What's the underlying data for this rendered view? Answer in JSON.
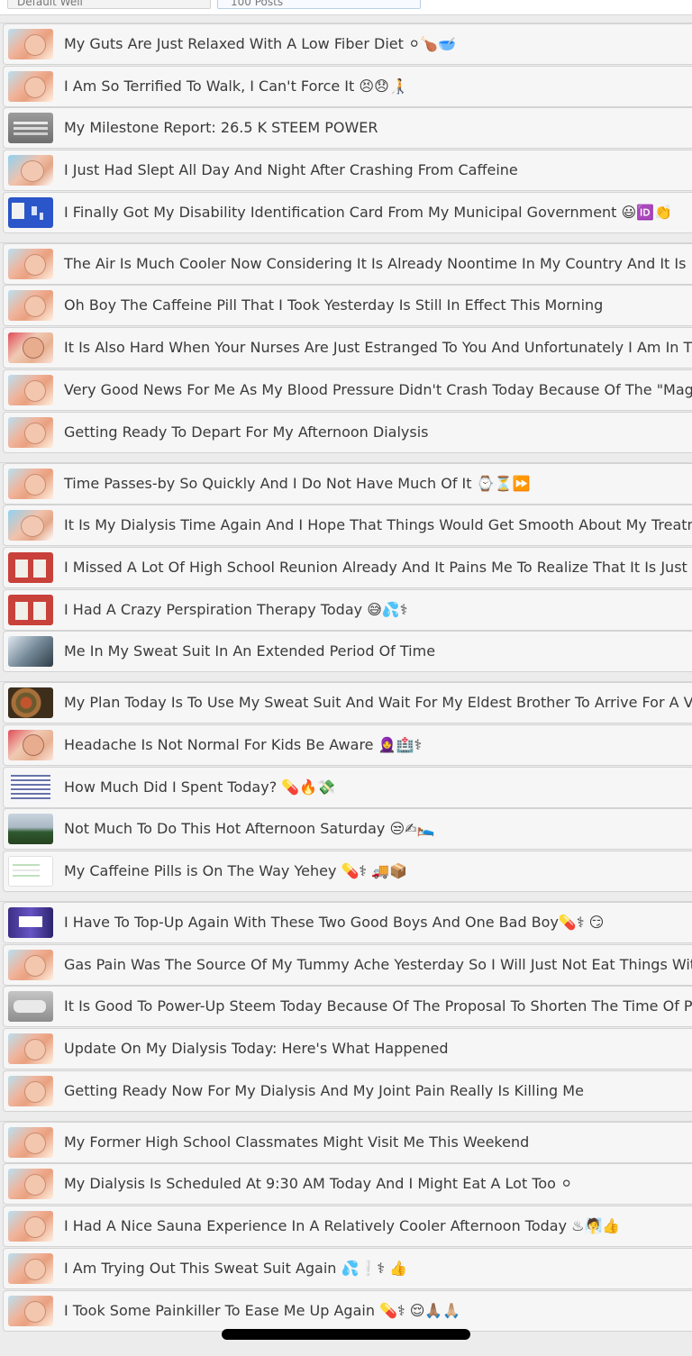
{
  "header": {
    "sort_select": "Default Well",
    "count_select": "100 Posts"
  },
  "groups": [
    {
      "posts": [
        {
          "title": "My Guts Are Just Relaxed With A Low Fiber Diet ⚪🍗🥣",
          "thumb": "face"
        },
        {
          "title": "I Am So Terrified To Walk, I Can't Force It 😣😞🧑‍🦯",
          "thumb": "face"
        },
        {
          "title": "My Milestone Report: 26.5 K STEEM POWER",
          "thumb": "gray"
        },
        {
          "title": "I Just Had Slept All Day And Night After Crashing From Caffeine",
          "thumb": "face3"
        },
        {
          "title": "I Finally Got My Disability Identification Card From My Municipal Government 😃🆔👏",
          "thumb": "card"
        }
      ]
    },
    {
      "posts": [
        {
          "title": "The Air Is Much Cooler Now Considering It Is Already Noontime In My Country And It Is Nice T",
          "thumb": "face"
        },
        {
          "title": "Oh Boy The Caffeine Pill That I Took Yesterday Is Still In Effect This Morning",
          "thumb": "face"
        },
        {
          "title": "It Is Also Hard When Your Nurses Are Just Estranged To You And Unfortunately I Am In That C",
          "thumb": "face2"
        },
        {
          "title": "Very Good News For Me As My Blood Pressure Didn't Crash Today Because Of The \"Magic Bu",
          "thumb": "face"
        },
        {
          "title": "Getting Ready To Depart For My Afternoon Dialysis",
          "thumb": "face"
        }
      ]
    },
    {
      "posts": [
        {
          "title": "Time Passes-by So Quickly And I Do Not Have Much Of It ⌚⏳⏩",
          "thumb": "face"
        },
        {
          "title": "It Is My Dialysis Time Again And I Hope That Things Would Get Smooth About My Treatment S",
          "thumb": "face3"
        },
        {
          "title": "I Missed A Lot Of High School Reunion Already And It Pains Me To Realize That It Is Just Impos",
          "thumb": "red"
        },
        {
          "title": "I Had A Crazy Perspiration Therapy Today 😅💦⚕",
          "thumb": "red"
        },
        {
          "title": "Me In My Sweat Suit In An Extended Period Of Time",
          "thumb": "photo"
        }
      ]
    },
    {
      "posts": [
        {
          "title": "My Plan Today Is To Use My Sweat Suit And Wait For My Eldest Brother To Arrive For A Visit",
          "thumb": "pizza"
        },
        {
          "title": "Headache Is Not Normal For Kids Be Aware 🧕🏥⚕",
          "thumb": "face2"
        },
        {
          "title": "How Much Did I Spent Today? 💊🔥💸",
          "thumb": "sheet"
        },
        {
          "title": "Not Much To Do This Hot Afternoon Saturday 😒✍🛌",
          "thumb": "sky"
        },
        {
          "title": "My Caffeine Pills is On The Way Yehey 💊⚕ 🚚📦",
          "thumb": "white"
        }
      ]
    },
    {
      "posts": [
        {
          "title": "I Have To Top-Up Again With These Two Good Boys And One Bad Boy💊⚕ 😏",
          "thumb": "bottle"
        },
        {
          "title": "Gas Pain Was The Source Of My Tummy Ache Yesterday So I Will Just Not Eat Things With Che",
          "thumb": "face"
        },
        {
          "title": "It Is Good To Power-Up Steem Today Because Of The Proposal To Shorten The Time Of Power",
          "thumb": "silver"
        },
        {
          "title": "Update On My Dialysis Today: Here's What Happened",
          "thumb": "face"
        },
        {
          "title": "Getting Ready Now For My Dialysis And My Joint Pain Really Is Killing Me",
          "thumb": "face"
        }
      ]
    },
    {
      "posts": [
        {
          "title": "My Former High School Classmates Might Visit Me This Weekend",
          "thumb": "face"
        },
        {
          "title": "My Dialysis Is Scheduled At 9:30 AM Today And I Might Eat A Lot Too ⚪",
          "thumb": "face"
        },
        {
          "title": "I Had A Nice Sauna Experience In A Relatively Cooler Afternoon Today ♨🧖👍",
          "thumb": "face"
        },
        {
          "title": "I Am Trying Out This Sweat Suit Again 💦❕⚕ 👍",
          "thumb": "face"
        },
        {
          "title": "I Took Some Painkiller To Ease Me Up Again 💊⚕ 😌🙏🏽🙏🏼",
          "thumb": "face"
        }
      ]
    }
  ]
}
